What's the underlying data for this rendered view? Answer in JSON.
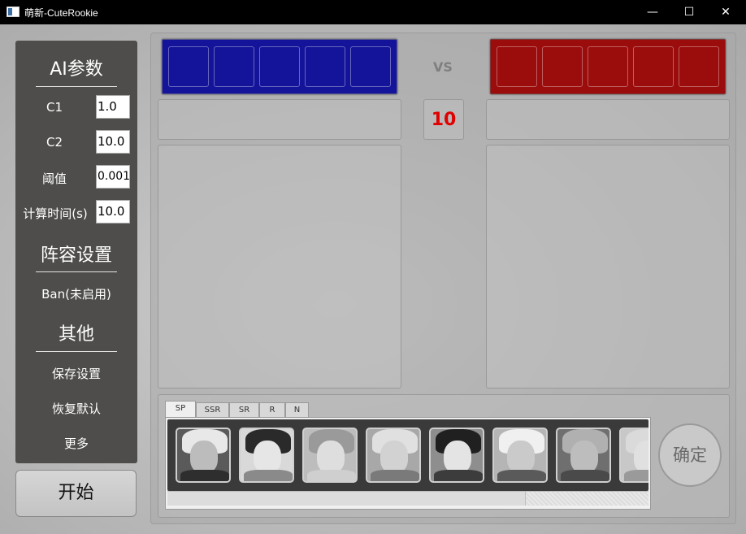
{
  "window": {
    "title": "萌新-CuteRookie",
    "minimize": "—",
    "maximize": "☐",
    "close": "✕"
  },
  "sidebar": {
    "ai_section": "AI参数",
    "params": [
      {
        "label": "C1",
        "value": "1.0"
      },
      {
        "label": "C2",
        "value": "10.0"
      },
      {
        "label": "阈值",
        "value": "0.001"
      },
      {
        "label": "计算时间(s)",
        "value": "10.0"
      }
    ],
    "lineup_section": "阵容设置",
    "ban_label": "Ban(未启用)",
    "other_section": "其他",
    "menu": [
      "保存设置",
      "恢复默认",
      "更多"
    ]
  },
  "start_button": "开始",
  "match": {
    "vs": "VS",
    "counter": "10",
    "blue_color": "#14149a",
    "red_color": "#9b0c0c"
  },
  "tabs": [
    "SP",
    "SSR",
    "SR",
    "R",
    "N"
  ],
  "active_tab": "SP",
  "heroes": [
    "hero-1",
    "hero-2",
    "hero-3",
    "hero-4",
    "hero-5",
    "hero-6",
    "hero-7",
    "hero-8"
  ],
  "scroll_fraction": 0.75,
  "confirm_button": "确定"
}
